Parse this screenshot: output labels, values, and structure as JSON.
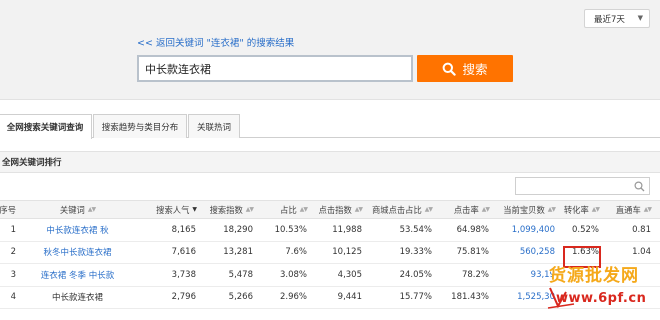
{
  "top": {
    "range_label": "最近7天",
    "back_link": "<< 返回关键词 \"连衣裙\" 的搜索结果",
    "search_value": "中长款连衣裙",
    "search_button": "搜索"
  },
  "tabs": [
    {
      "label": "全网搜索关键词查询",
      "active": true
    },
    {
      "label": "搜索趋势与类目分布",
      "active": false
    },
    {
      "label": "关联热词",
      "active": false
    }
  ],
  "panel_title": "全网关键词排行",
  "table": {
    "headers": {
      "idx": "序号",
      "keyword": "关键词",
      "popularity": "搜索人气",
      "index": "搜索指数",
      "share": "占比",
      "click_index": "点击指数",
      "mall_share": "商城点击占比",
      "ctr": "点击率",
      "items": "当前宝贝数",
      "cvr": "转化率",
      "train": "直通车"
    },
    "rows": [
      {
        "idx": "1",
        "keyword": "中长款连衣裙 秋",
        "popularity": "8,165",
        "index": "18,290",
        "share": "10.53%",
        "click_index": "11,988",
        "mall_share": "53.54%",
        "ctr": "64.98%",
        "items": "1,099,400",
        "cvr": "0.52%",
        "train": "0.81"
      },
      {
        "idx": "2",
        "keyword": "秋冬中长款连衣裙",
        "popularity": "7,616",
        "index": "13,281",
        "share": "7.6%",
        "click_index": "10,125",
        "mall_share": "19.33%",
        "ctr": "75.81%",
        "items": "560,258",
        "cvr": "1.63%",
        "train": "1.04"
      },
      {
        "idx": "3",
        "keyword": "连衣裙 冬季 中长款",
        "popularity": "3,738",
        "index": "5,478",
        "share": "3.08%",
        "click_index": "4,305",
        "mall_share": "24.05%",
        "ctr": "78.2%",
        "items": "93,19",
        "cvr": "",
        "train": ""
      },
      {
        "idx": "4",
        "keyword": "中长款连衣裙",
        "popularity": "2,796",
        "index": "5,266",
        "share": "2.96%",
        "click_index": "9,441",
        "mall_share": "15.77%",
        "ctr": "181.43%",
        "items": "1,525,30",
        "cvr": "",
        "train": ""
      }
    ]
  },
  "watermark": {
    "line1": "货源批发网",
    "line2": "www.6pf.cn"
  },
  "colors": {
    "accent": "#ff7300",
    "link": "#2a6fc9",
    "highlight": "#d9281e",
    "watermark": "#f5a91a"
  }
}
